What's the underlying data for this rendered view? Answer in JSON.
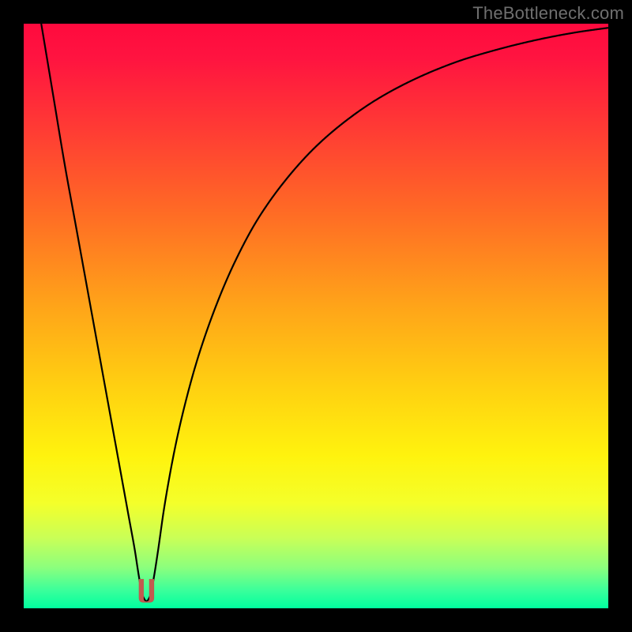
{
  "watermark": "TheBottleneck.com",
  "gradient": {
    "stops": [
      {
        "offset": 0.0,
        "color": "#ff0a3e"
      },
      {
        "offset": 0.06,
        "color": "#ff1440"
      },
      {
        "offset": 0.18,
        "color": "#ff3b34"
      },
      {
        "offset": 0.32,
        "color": "#ff6a25"
      },
      {
        "offset": 0.48,
        "color": "#ffa319"
      },
      {
        "offset": 0.62,
        "color": "#ffd011"
      },
      {
        "offset": 0.74,
        "color": "#fff30e"
      },
      {
        "offset": 0.82,
        "color": "#f4ff2a"
      },
      {
        "offset": 0.88,
        "color": "#c9ff57"
      },
      {
        "offset": 0.93,
        "color": "#8cff7d"
      },
      {
        "offset": 0.97,
        "color": "#39ff9b"
      },
      {
        "offset": 1.0,
        "color": "#00ff9f"
      }
    ]
  },
  "curve": {
    "stroke": "#000000",
    "stroke_width": 2.2
  },
  "tick": {
    "color": "#c25a4f",
    "stroke": "#a84b42"
  },
  "chart_data": {
    "type": "line",
    "title": "",
    "xlabel": "",
    "ylabel": "",
    "xlim": [
      0,
      100
    ],
    "ylim": [
      0,
      100
    ],
    "x_min_point": 21,
    "series": [
      {
        "name": "bottleneck-curve",
        "x": [
          3,
          5,
          7,
          9,
          11,
          13,
          15,
          17,
          18,
          19,
          19.7,
          20.3,
          21,
          21.7,
          22.3,
          23,
          24,
          26,
          28,
          30,
          33,
          36,
          40,
          45,
          50,
          55,
          60,
          65,
          70,
          75,
          80,
          85,
          90,
          95,
          100
        ],
        "y": [
          100,
          88,
          76,
          65,
          54,
          43,
          32,
          21,
          15.5,
          10,
          5.5,
          2.3,
          1.2,
          2.3,
          5.5,
          10,
          17,
          28,
          36.5,
          43.5,
          52,
          59,
          66.5,
          73.5,
          79,
          83.3,
          86.8,
          89.6,
          91.9,
          93.8,
          95.3,
          96.6,
          97.7,
          98.6,
          99.3
        ]
      }
    ],
    "marker": {
      "name": "min-tick",
      "x_range": [
        19.7,
        22.3
      ],
      "y_range": [
        1.0,
        5.0
      ]
    }
  }
}
